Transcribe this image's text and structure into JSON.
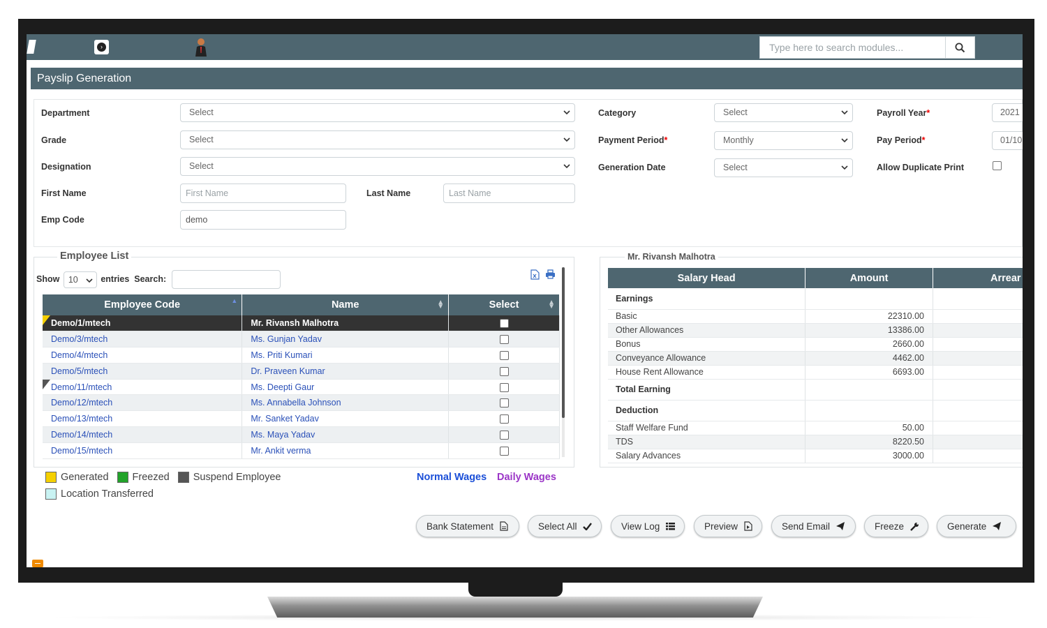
{
  "header": {
    "search_placeholder": "Type here to search modules..."
  },
  "page": {
    "title": "Payslip Generation"
  },
  "filters": {
    "department": {
      "label": "Department",
      "value": "Select"
    },
    "grade": {
      "label": "Grade",
      "value": "Select"
    },
    "designation": {
      "label": "Designation",
      "value": "Select"
    },
    "first_name": {
      "label": "First Name",
      "placeholder": "First Name"
    },
    "last_name": {
      "label": "Last Name",
      "placeholder": "Last Name"
    },
    "emp_code": {
      "label": "Emp Code",
      "value": "demo"
    },
    "category": {
      "label": "Category",
      "value": "Select"
    },
    "payment_period": {
      "label": "Payment Period",
      "value": "Monthly"
    },
    "generation_date": {
      "label": "Generation Date",
      "value": "Select"
    },
    "payroll_year": {
      "label": "Payroll Year",
      "value": "2021"
    },
    "pay_period": {
      "label": "Pay Period",
      "value": "01/10"
    },
    "allow_duplicate_print": {
      "label": "Allow Duplicate Print",
      "checked": false
    }
  },
  "employee_list": {
    "title": "Employee List",
    "show_label": "Show",
    "entries_value": "10",
    "entries_label": "entries",
    "search_label": "Search:",
    "columns": [
      "Employee Code",
      "Name",
      "Select"
    ],
    "rows": [
      {
        "code": "Demo/1/mtech",
        "name": "Mr. Rivansh Malhotra",
        "flag": "generated",
        "active": true
      },
      {
        "code": "Demo/3/mtech",
        "name": "Ms. Gunjan Yadav",
        "flag": "",
        "active": false
      },
      {
        "code": "Demo/4/mtech",
        "name": "Ms. Priti Kumari",
        "flag": "",
        "active": false
      },
      {
        "code": "Demo/5/mtech",
        "name": "Dr. Praveen Kumar",
        "flag": "",
        "active": false
      },
      {
        "code": "Demo/11/mtech",
        "name": "Ms. Deepti Gaur",
        "flag": "suspend",
        "active": false
      },
      {
        "code": "Demo/12/mtech",
        "name": "Ms. Annabella Johnson",
        "flag": "",
        "active": false
      },
      {
        "code": "Demo/13/mtech",
        "name": "Mr. Sanket Yadav",
        "flag": "",
        "active": false
      },
      {
        "code": "Demo/14/mtech",
        "name": "Ms. Maya Yadav",
        "flag": "",
        "active": false
      },
      {
        "code": "Demo/15/mtech",
        "name": "Mr. Ankit verma",
        "flag": "",
        "active": false
      }
    ]
  },
  "legend": {
    "generated": "Generated",
    "freezed": "Freezed",
    "suspend": "Suspend Employee",
    "location": "Location Transferred",
    "colors": {
      "generated": "#f5d000",
      "freezed": "#22a32a",
      "suspend": "#555555",
      "location": "#c9f3f3"
    }
  },
  "wages": {
    "normal": "Normal Wages",
    "daily": "Daily Wages",
    "normal_color": "#1b4fd8",
    "daily_color": "#9b35c7"
  },
  "salary": {
    "employee": "Mr. Rivansh Malhotra",
    "columns": [
      "Salary Head",
      "Amount",
      "Arrear"
    ],
    "earnings_label": "Earnings",
    "earnings": [
      {
        "head": "Basic",
        "amount": "22310.00"
      },
      {
        "head": "Other Allowances",
        "amount": "13386.00"
      },
      {
        "head": "Bonus",
        "amount": "2660.00"
      },
      {
        "head": "Conveyance Allowance",
        "amount": "4462.00"
      },
      {
        "head": "House Rent Allowance",
        "amount": "6693.00"
      }
    ],
    "total_earning_label": "Total Earning",
    "deduction_label": "Deduction",
    "deductions": [
      {
        "head": "Staff Welfare Fund",
        "amount": "50.00"
      },
      {
        "head": "TDS",
        "amount": "8220.50"
      },
      {
        "head": "Salary Advances",
        "amount": "3000.00"
      }
    ]
  },
  "actions": {
    "bank_statement": "Bank Statement",
    "select_all": "Select All",
    "view_log": "View Log",
    "preview": "Preview",
    "send_email": "Send Email",
    "freeze": "Freeze",
    "generate": "Generate"
  },
  "theme": {
    "primary": "#4e6670"
  }
}
